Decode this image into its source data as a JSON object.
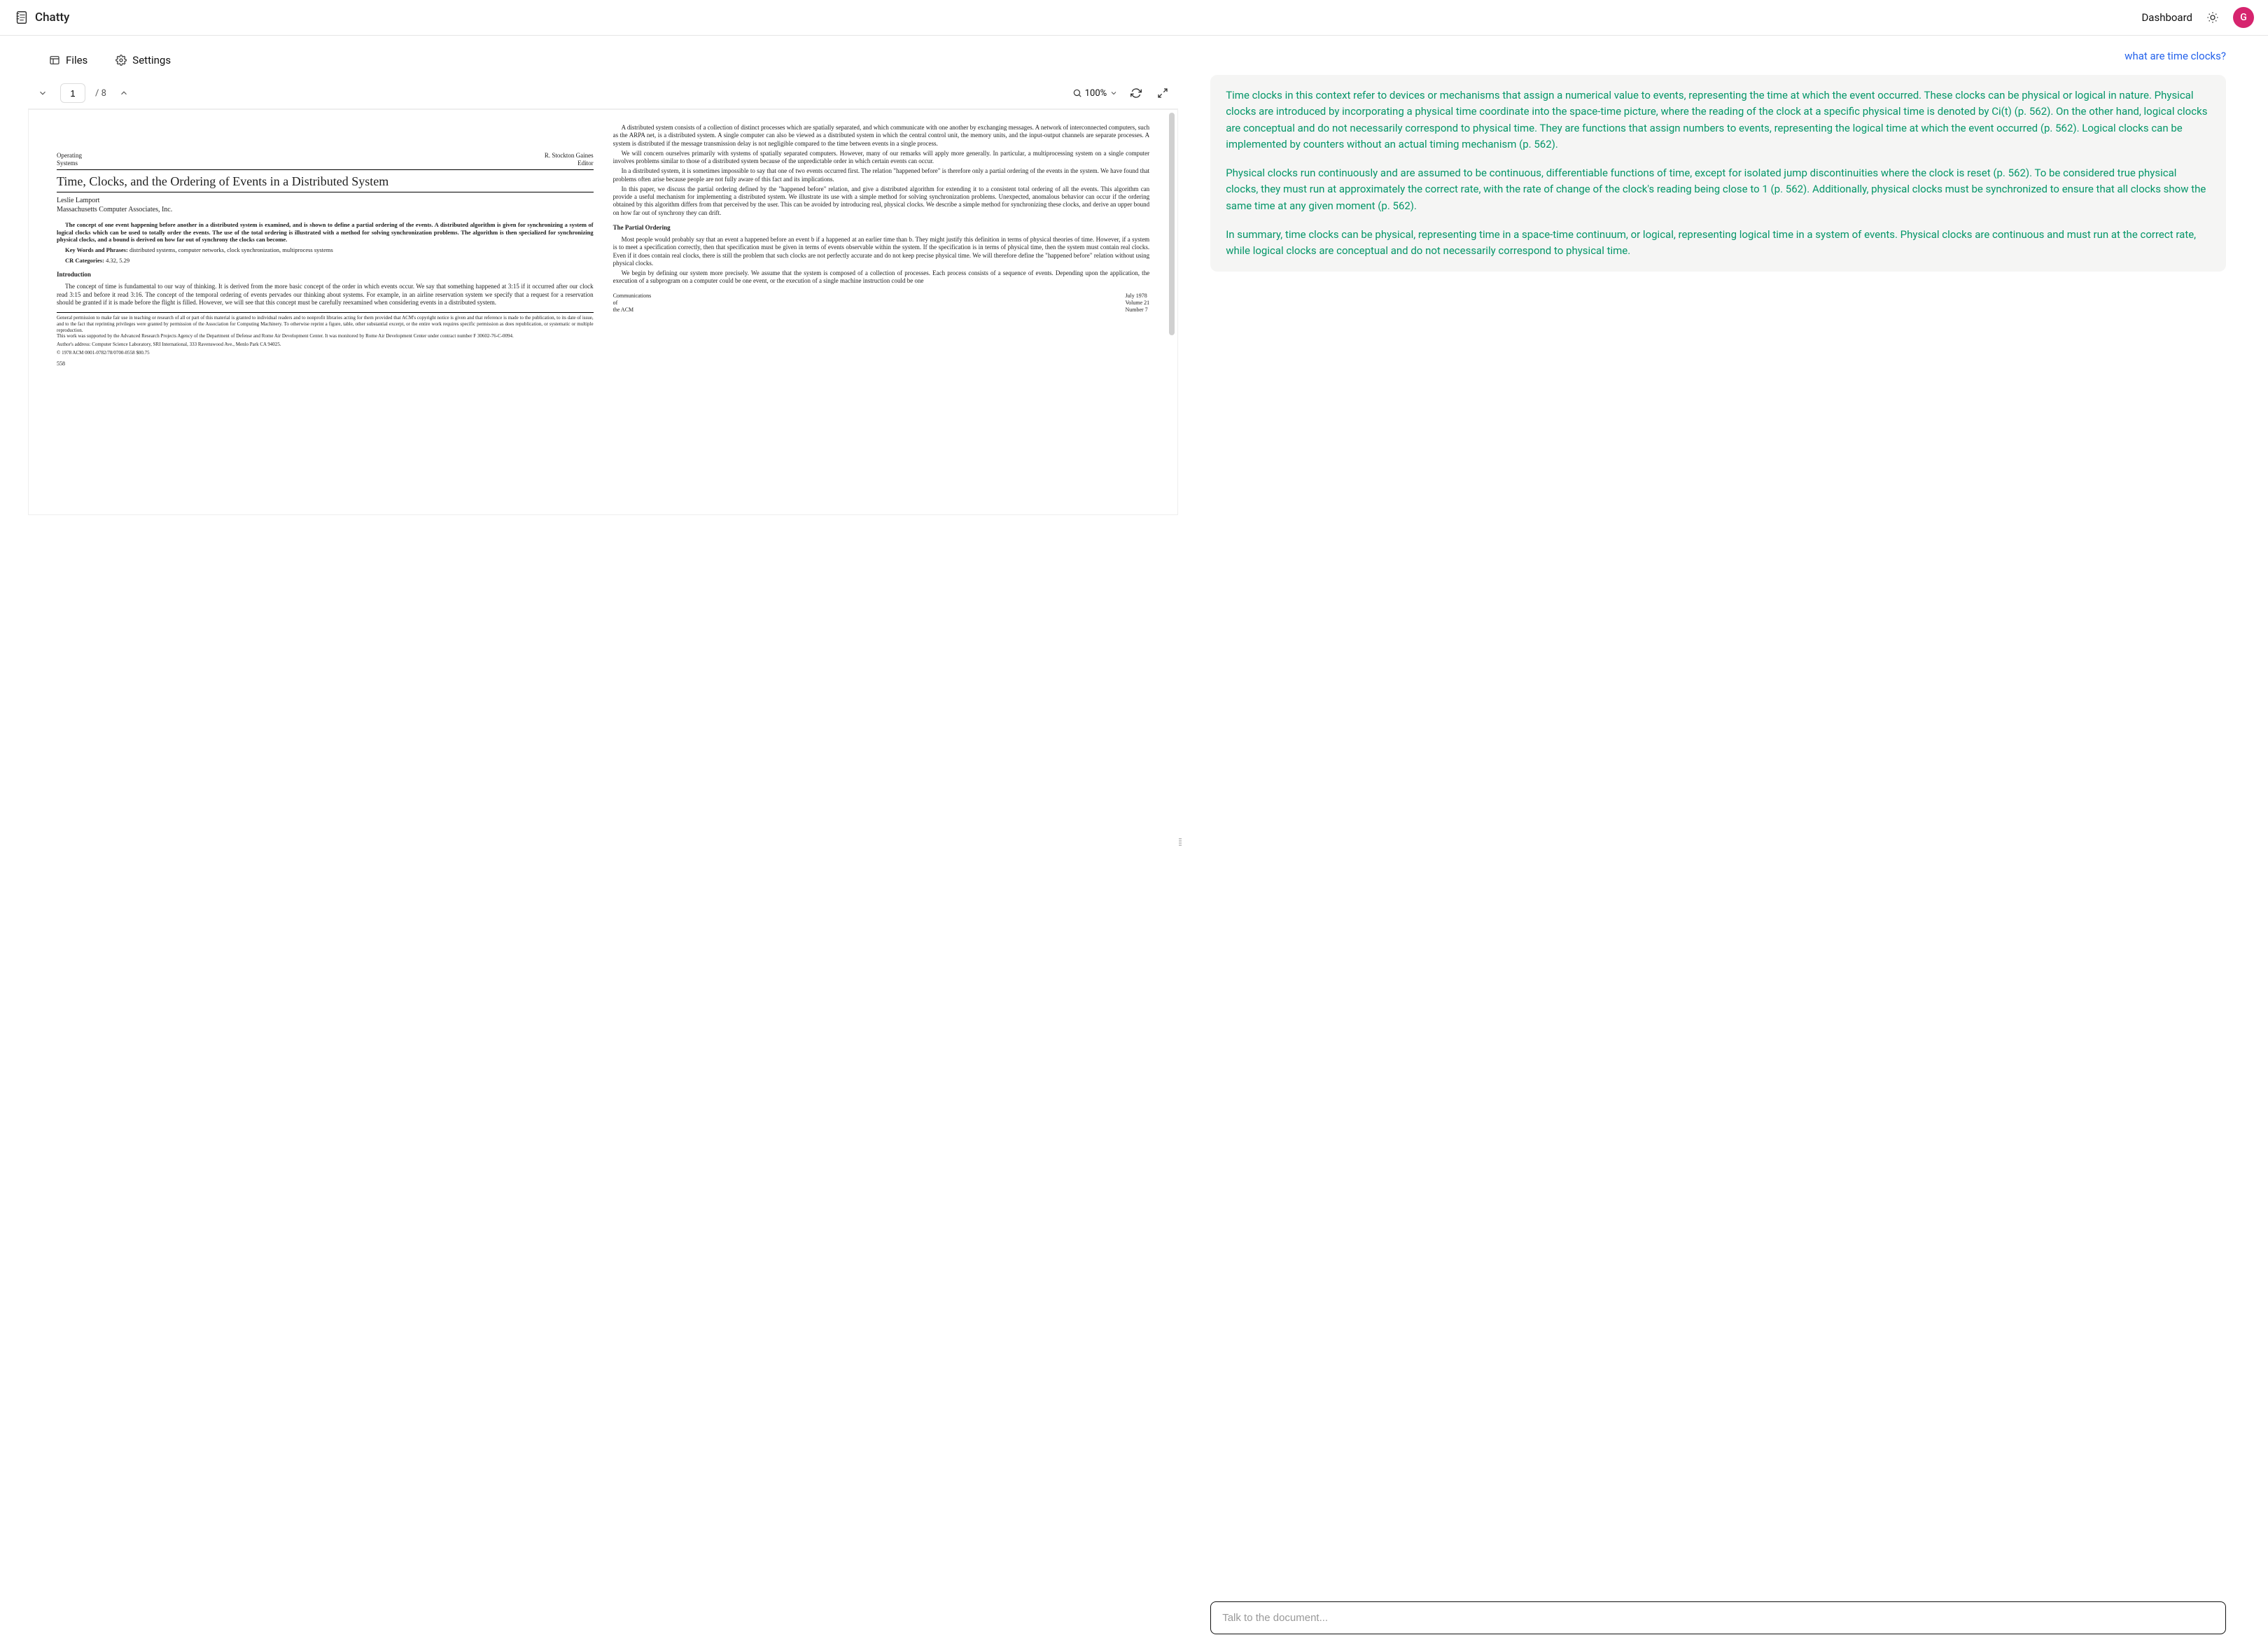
{
  "header": {
    "app_name": "Chatty",
    "dashboard_label": "Dashboard",
    "avatar_initial": "G"
  },
  "tabs": {
    "files": "Files",
    "settings": "Settings"
  },
  "toolbar": {
    "page_current": "1",
    "page_total": "/ 8",
    "zoom_label": "100%"
  },
  "document": {
    "header_left": "Operating\nSystems",
    "header_right": "R. Stockton Gaines\nEditor",
    "title": "Time, Clocks, and the Ordering of Events in a Distributed System",
    "author": "Leslie Lamport",
    "affiliation": "Massachusetts Computer Associates, Inc.",
    "abstract": "The concept of one event happening before another in a distributed system is examined, and is shown to define a partial ordering of the events. A distributed algorithm is given for synchronizing a system of logical clocks which can be used to totally order the events. The use of the total ordering is illustrated with a method for solving synchronization problems. The algorithm is then specialized for synchronizing physical clocks, and a bound is derived on how far out of synchrony the clocks can become.",
    "keywords_label": "Key Words and Phrases:",
    "keywords": "distributed systems, computer networks, clock synchronization, multiprocess systems",
    "cr_label": "CR Categories:",
    "cr": "4.32, 5.29",
    "intro_h": "Introduction",
    "intro_p1": "The concept of time is fundamental to our way of thinking. It is derived from the more basic concept of the order in which events occur. We say that something happened at 3:15 if it occurred after our clock read 3:15 and before it read 3:16. The concept of the temporal ordering of events pervades our thinking about systems. For example, in an airline reservation system we specify that a request for a reservation should be granted if it is made before the flight is filled. However, we will see that this concept must be carefully reexamined when considering events in a distributed system.",
    "fn1": "General permission to make fair use in teaching or research of all or part of this material is granted to individual readers and to nonprofit libraries acting for them provided that ACM's copyright notice is given and that reference is made to the publication, to its date of issue, and to the fact that reprinting privileges were granted by permission of the Association for Computing Machinery. To otherwise reprint a figure, table, other substantial excerpt, or the entire work requires specific permission as does republication, or systematic or multiple reproduction.",
    "fn2": "This work was supported by the Advanced Research Projects Agency of the Department of Defense and Rome Air Development Center. It was monitored by Rome Air Development Center under contract number F 30602-76-C-0094.",
    "fn3": "Author's address: Computer Science Laboratory, SRI International, 333 Ravenswood Ave., Menlo Park CA 94025.",
    "fn4": "© 1978 ACM 0001-0782/78/0700-0558 $00.75",
    "page_num": "558",
    "col2_p1": "A distributed system consists of a collection of distinct processes which are spatially separated, and which communicate with one another by exchanging messages. A network of interconnected computers, such as the ARPA net, is a distributed system. A single computer can also be viewed as a distributed system in which the central control unit, the memory units, and the input-output channels are separate processes. A system is distributed if the message transmission delay is not negligible compared to the time between events in a single process.",
    "col2_p2": "We will concern ourselves primarily with systems of spatially separated computers. However, many of our remarks will apply more generally. In particular, a multiprocessing system on a single computer involves problems similar to those of a distributed system because of the unpredictable order in which certain events can occur.",
    "col2_p3": "In a distributed system, it is sometimes impossible to say that one of two events occurred first. The relation \"happened before\" is therefore only a partial ordering of the events in the system. We have found that problems often arise because people are not fully aware of this fact and its implications.",
    "col2_p4": "In this paper, we discuss the partial ordering defined by the \"happened before\" relation, and give a distributed algorithm for extending it to a consistent total ordering of all the events. This algorithm can provide a useful mechanism for implementing a distributed system. We illustrate its use with a simple method for solving synchronization problems. Unexpected, anomalous behavior can occur if the ordering obtained by this algorithm differs from that perceived by the user. This can be avoided by introducing real, physical clocks. We describe a simple method for synchronizing these clocks, and derive an upper bound on how far out of synchrony they can drift.",
    "col2_h": "The Partial Ordering",
    "col2_p5": "Most people would probably say that an event a happened before an event b if a happened at an earlier time than b. They might justify this definition in terms of physical theories of time. However, if a system is to meet a specification correctly, then that specification must be given in terms of events observable within the system. If the specification is in terms of physical time, then the system must contain real clocks. Even if it does contain real clocks, there is still the problem that such clocks are not perfectly accurate and do not keep precise physical time. We will therefore define the \"happened before\" relation without using physical clocks.",
    "col2_p6": "We begin by defining our system more precisely. We assume that the system is composed of a collection of processes. Each process consists of a sequence of events. Depending upon the application, the execution of a subprogram on a computer could be one event, or the execution of a single machine instruction could be one",
    "footer_c": "Communications\nof\nthe ACM",
    "footer_r": "July 1978\nVolume 21\nNumber 7"
  },
  "chat": {
    "user_question": "what are time clocks?",
    "asst_p1": "Time clocks in this context refer to devices or mechanisms that assign a numerical value to events, representing the time at which the event occurred. These clocks can be physical or logical in nature. Physical clocks are introduced by incorporating a physical time coordinate into the space-time picture, where the reading of the clock at a specific physical time is denoted by Ci(t) (p. 562). On the other hand, logical clocks are conceptual and do not necessarily correspond to physical time. They are functions that assign numbers to events, representing the logical time at which the event occurred (p. 562). Logical clocks can be implemented by counters without an actual timing mechanism (p. 562).",
    "asst_p2": "Physical clocks run continuously and are assumed to be continuous, differentiable functions of time, except for isolated jump discontinuities where the clock is reset (p. 562). To be considered true physical clocks, they must run at approximately the correct rate, with the rate of change of the clock's reading being close to 1 (p. 562). Additionally, physical clocks must be synchronized to ensure that all clocks show the same time at any given moment (p. 562).",
    "asst_p3": "In summary, time clocks can be physical, representing time in a space-time continuum, or logical, representing logical time in a system of events. Physical clocks are continuous and must run at the correct rate, while logical clocks are conceptual and do not necessarily correspond to physical time.",
    "input_placeholder": "Talk to the document..."
  }
}
